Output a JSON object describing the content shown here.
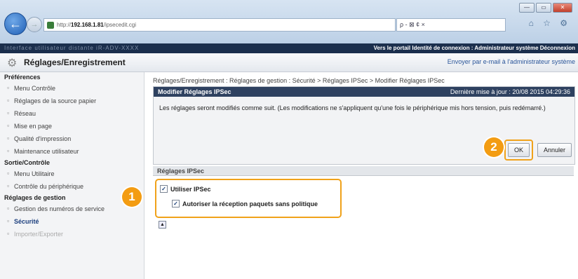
{
  "browser": {
    "url_prefix": "http://",
    "url_host": "192.168.1.81",
    "url_path": "/ipsecedit.cgi",
    "address_tools": "ρ - ⊠ ¢ ×",
    "window_min": "—",
    "window_max": "▭",
    "window_close": "✕",
    "back_glyph": "←",
    "forward_glyph": "→",
    "toolbar_glyphs": "⌂ ☆ ⚙"
  },
  "topbar": {
    "blurred_left": "Interface utilisateur distante   iR-ADV-XXXX",
    "links": "Vers le portail   Identité de connexion : Administrateur système Déconnexion"
  },
  "header": {
    "title": "Réglages/Enregistrement",
    "mail_link": "Envoyer par e-mail à l'administrateur système"
  },
  "sidebar": {
    "sections": [
      {
        "label": "Préférences",
        "items": [
          "Menu Contrôle",
          "Réglages de la source papier",
          "Réseau",
          "Mise en page",
          "Qualité d'impression",
          "Maintenance utilisateur"
        ]
      },
      {
        "label": "Sortie/Contrôle",
        "items": [
          "Menu Utilitaire",
          "Contrôle du périphérique"
        ]
      },
      {
        "label": "Réglages de gestion",
        "items": [
          "Gestion des numéros de service",
          "Sécurité",
          "Importer/Exporter"
        ]
      }
    ]
  },
  "main": {
    "breadcrumb": "Réglages/Enregistrement : Réglages de gestion : Sécurité > Réglages IPSec > Modifier Réglages IPSec",
    "panel_title": "Modifier Réglages IPSec",
    "last_update": "Dernière mise à jour : 20/08 2015 04:29:36",
    "message": "Les réglages seront modifiés comme suit. (Les modifications ne s'appliquent qu'une fois le périphérique mis hors tension, puis redémarré.)",
    "ok_label": "OK",
    "cancel_label": "Annuler",
    "ipsec_header": "Réglages IPSec",
    "use_ipsec_label": "Utiliser IPSec",
    "allow_label": "Autoriser la réception paquets sans politique",
    "check_glyph": "✓",
    "top_icon": "▲"
  },
  "callouts": {
    "one": "1",
    "two": "2"
  },
  "colors": {
    "accent": "#f39c12",
    "header_dark": "#2e4160",
    "topbar": "#1b2f4d"
  }
}
